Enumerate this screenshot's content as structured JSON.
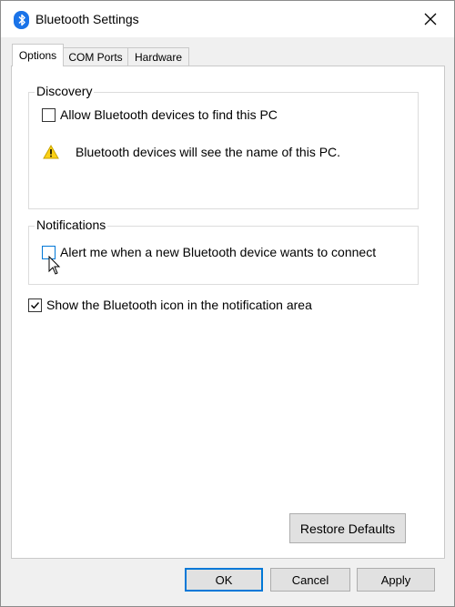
{
  "window": {
    "title": "Bluetooth Settings",
    "accent_color": "#0078d7",
    "icon": "bluetooth-icon",
    "close_icon": "close-icon"
  },
  "tabs": [
    {
      "label": "Options",
      "active": true
    },
    {
      "label": "COM Ports",
      "active": false
    },
    {
      "label": "Hardware",
      "active": false
    }
  ],
  "discovery": {
    "legend": "Discovery",
    "allow_label": "Allow Bluetooth devices to find this PC",
    "allow_checked": false,
    "warning_icon": "warning-icon",
    "warning_text": "Bluetooth devices will see the name of this PC."
  },
  "notifications": {
    "legend": "Notifications",
    "alert_label": "Alert me when a new Bluetooth device wants to connect",
    "alert_checked": false
  },
  "show_icon": {
    "label": "Show the Bluetooth icon in the notification area",
    "checked": true
  },
  "buttons": {
    "restore_defaults": "Restore Defaults",
    "ok": "OK",
    "cancel": "Cancel",
    "apply": "Apply"
  }
}
